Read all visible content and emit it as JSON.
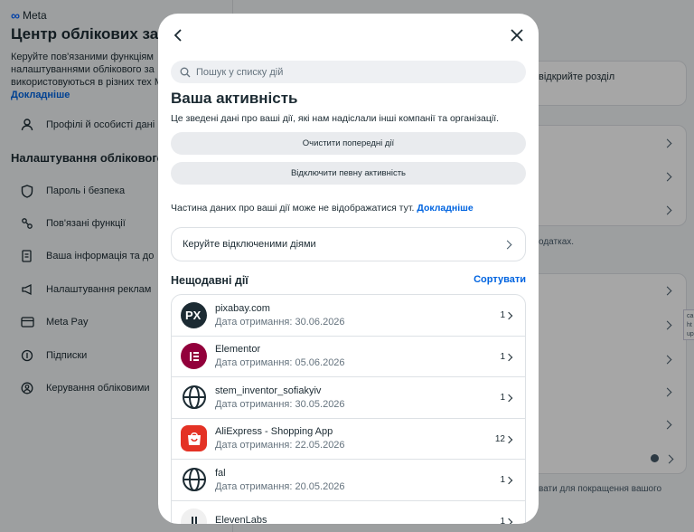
{
  "background": {
    "logo": "Meta",
    "title": "Центр облікових за",
    "description": "Керуйте пов'язаними функціям налаштуваннями облікового за використовуються в різних тех Meta.",
    "description_link": "Докладніше",
    "profiles_item": "Профілі й особисті дані",
    "section_title": "Налаштування облікового з",
    "menu": [
      {
        "label": "Пароль і безпека",
        "icon": "shield-icon"
      },
      {
        "label": "Пов'язані функції",
        "icon": "connected-icon"
      },
      {
        "label": "Ваша інформація та до",
        "icon": "info-icon"
      },
      {
        "label": "Налаштування реклам",
        "icon": "megaphone-icon"
      },
      {
        "label": "Meta Pay",
        "icon": "card-icon"
      },
      {
        "label": "Підписки",
        "icon": "subscriptions-icon"
      },
      {
        "label": "Керування обліковими",
        "icon": "account-icon"
      }
    ],
    "right_open_section": "відкрийте розділ",
    "right_apps_note": "одатках.",
    "right_bottom_note": "вати для покращення вашого",
    "tooltip_text": "са\nht\nup"
  },
  "modal": {
    "search_placeholder": "Пошук у списку дій",
    "title": "Ваша активність",
    "description": "Це зведені дані про ваші дії, які нам надіслали інші компанії та організації.",
    "clear_button": "Очистити попередні дії",
    "disconnect_button": "Відключити певну активність",
    "note": "Частина даних про ваші дії може не відображатися тут.",
    "note_link": "Докладніше",
    "manage_label": "Керуйте відключеними діями",
    "recent_title": "Нещодавні дії",
    "sort_label": "Сортувати",
    "items": [
      {
        "name": "pixabay.com",
        "date": "Дата отримання: 30.06.2026",
        "count": "1",
        "icon": "pixabay-logo-icon",
        "color": "#1c2b33"
      },
      {
        "name": "Elementor",
        "date": "Дата отримання: 05.06.2026",
        "count": "1",
        "icon": "elementor-logo-icon",
        "color": "#92003b"
      },
      {
        "name": "stem_inventor_sofiakyiv",
        "date": "Дата отримання: 30.05.2026",
        "count": "1",
        "icon": "globe-icon",
        "color": "#1c2b33"
      },
      {
        "name": "AliExpress - Shopping App",
        "date": "Дата отримання: 22.05.2026",
        "count": "12",
        "icon": "aliexpress-logo-icon",
        "color": "#e43225"
      },
      {
        "name": "fal",
        "date": "Дата отримання: 20.05.2026",
        "count": "1",
        "icon": "globe-icon",
        "color": "#1c2b33"
      },
      {
        "name": "ElevenLabs",
        "date": "",
        "count": "1",
        "icon": "elevenlabs-logo-icon",
        "color": "#1c2b33"
      }
    ]
  }
}
